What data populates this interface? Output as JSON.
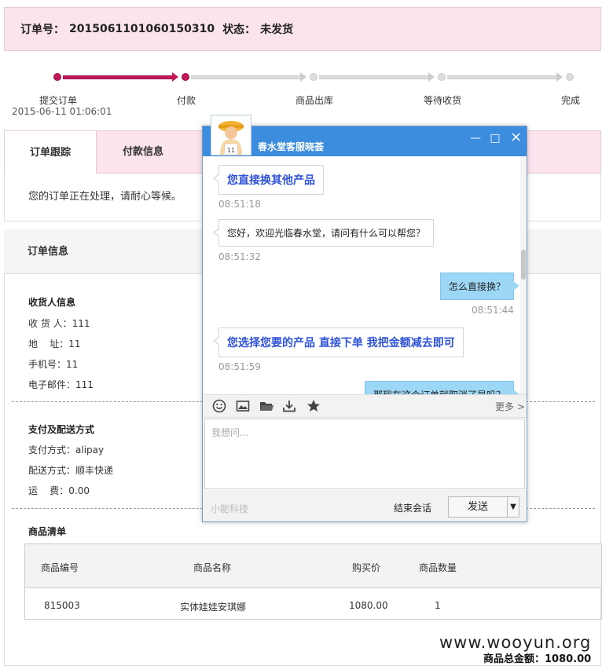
{
  "order": {
    "number_label": "订单号：",
    "number": "2015061101060150310",
    "status_label": "状态：",
    "status": "未发货"
  },
  "progress": {
    "steps": [
      {
        "label": "提交订单",
        "time": "2015-06-11 01:06:01",
        "active": true
      },
      {
        "label": "付款",
        "active": true
      },
      {
        "label": "商品出库",
        "active": false
      },
      {
        "label": "等待收货",
        "active": false
      },
      {
        "label": "完成",
        "active": false
      }
    ],
    "active_color": "#c2185b"
  },
  "tabs": {
    "items": [
      {
        "label": "订单跟踪",
        "active": true
      },
      {
        "label": "付款信息",
        "active": false
      }
    ],
    "message": "您的订单正在处理，请耐心等候。"
  },
  "order_info": {
    "title": "订单信息",
    "receiver": {
      "title": "收货人信息",
      "name": "收 货 人：111",
      "address": "地    址：11",
      "phone": "手机号：11",
      "email": "电子邮件：111"
    },
    "payment": {
      "title": "支付及配送方式",
      "pay_method": "支付方式：alipay",
      "ship_method": "配送方式：顺丰快递",
      "freight": "运    费：0.00"
    },
    "products": {
      "title": "商品清单",
      "columns": [
        "商品编号",
        "商品名称",
        "购买价",
        "商品数量"
      ],
      "rows": [
        [
          "815003",
          "实体娃娃安琪娜",
          "1080.00",
          "1"
        ]
      ]
    },
    "total": "商品总金额：1080.00"
  },
  "watermark": "www.wooyun.org",
  "chat": {
    "title": "春水堂客服晓荟",
    "avatar_icon": "basketball-player-icon",
    "header_color": "#3c8dde",
    "messages": [
      {
        "from": "agent",
        "text": "您直接换其他产品",
        "time": "08:51:18",
        "emphasis": true
      },
      {
        "from": "agent",
        "text": "您好，欢迎光临春水堂，请问有什么可以帮您？",
        "time": "08:51:32",
        "emphasis": false
      },
      {
        "from": "user",
        "text": "怎么直接换？",
        "time": "08:51:44",
        "emphasis": false
      },
      {
        "from": "agent",
        "text": "您选择您要的产品 直接下单 我把金额减去即可",
        "time": "08:51:59",
        "emphasis": true
      },
      {
        "from": "user",
        "text": "那现在这个订单就取消了是吗？",
        "time": "",
        "emphasis": false
      }
    ],
    "toolbar": {
      "icons": [
        "smile-icon",
        "image-icon",
        "folder-icon",
        "download-icon",
        "star-icon"
      ],
      "more": "更多 >"
    },
    "input_placeholder": "我想问...",
    "brand": "小能科技",
    "end_label": "结束会话",
    "send_label": "发送",
    "minimize": "—",
    "maximize": "□",
    "close": "×"
  }
}
